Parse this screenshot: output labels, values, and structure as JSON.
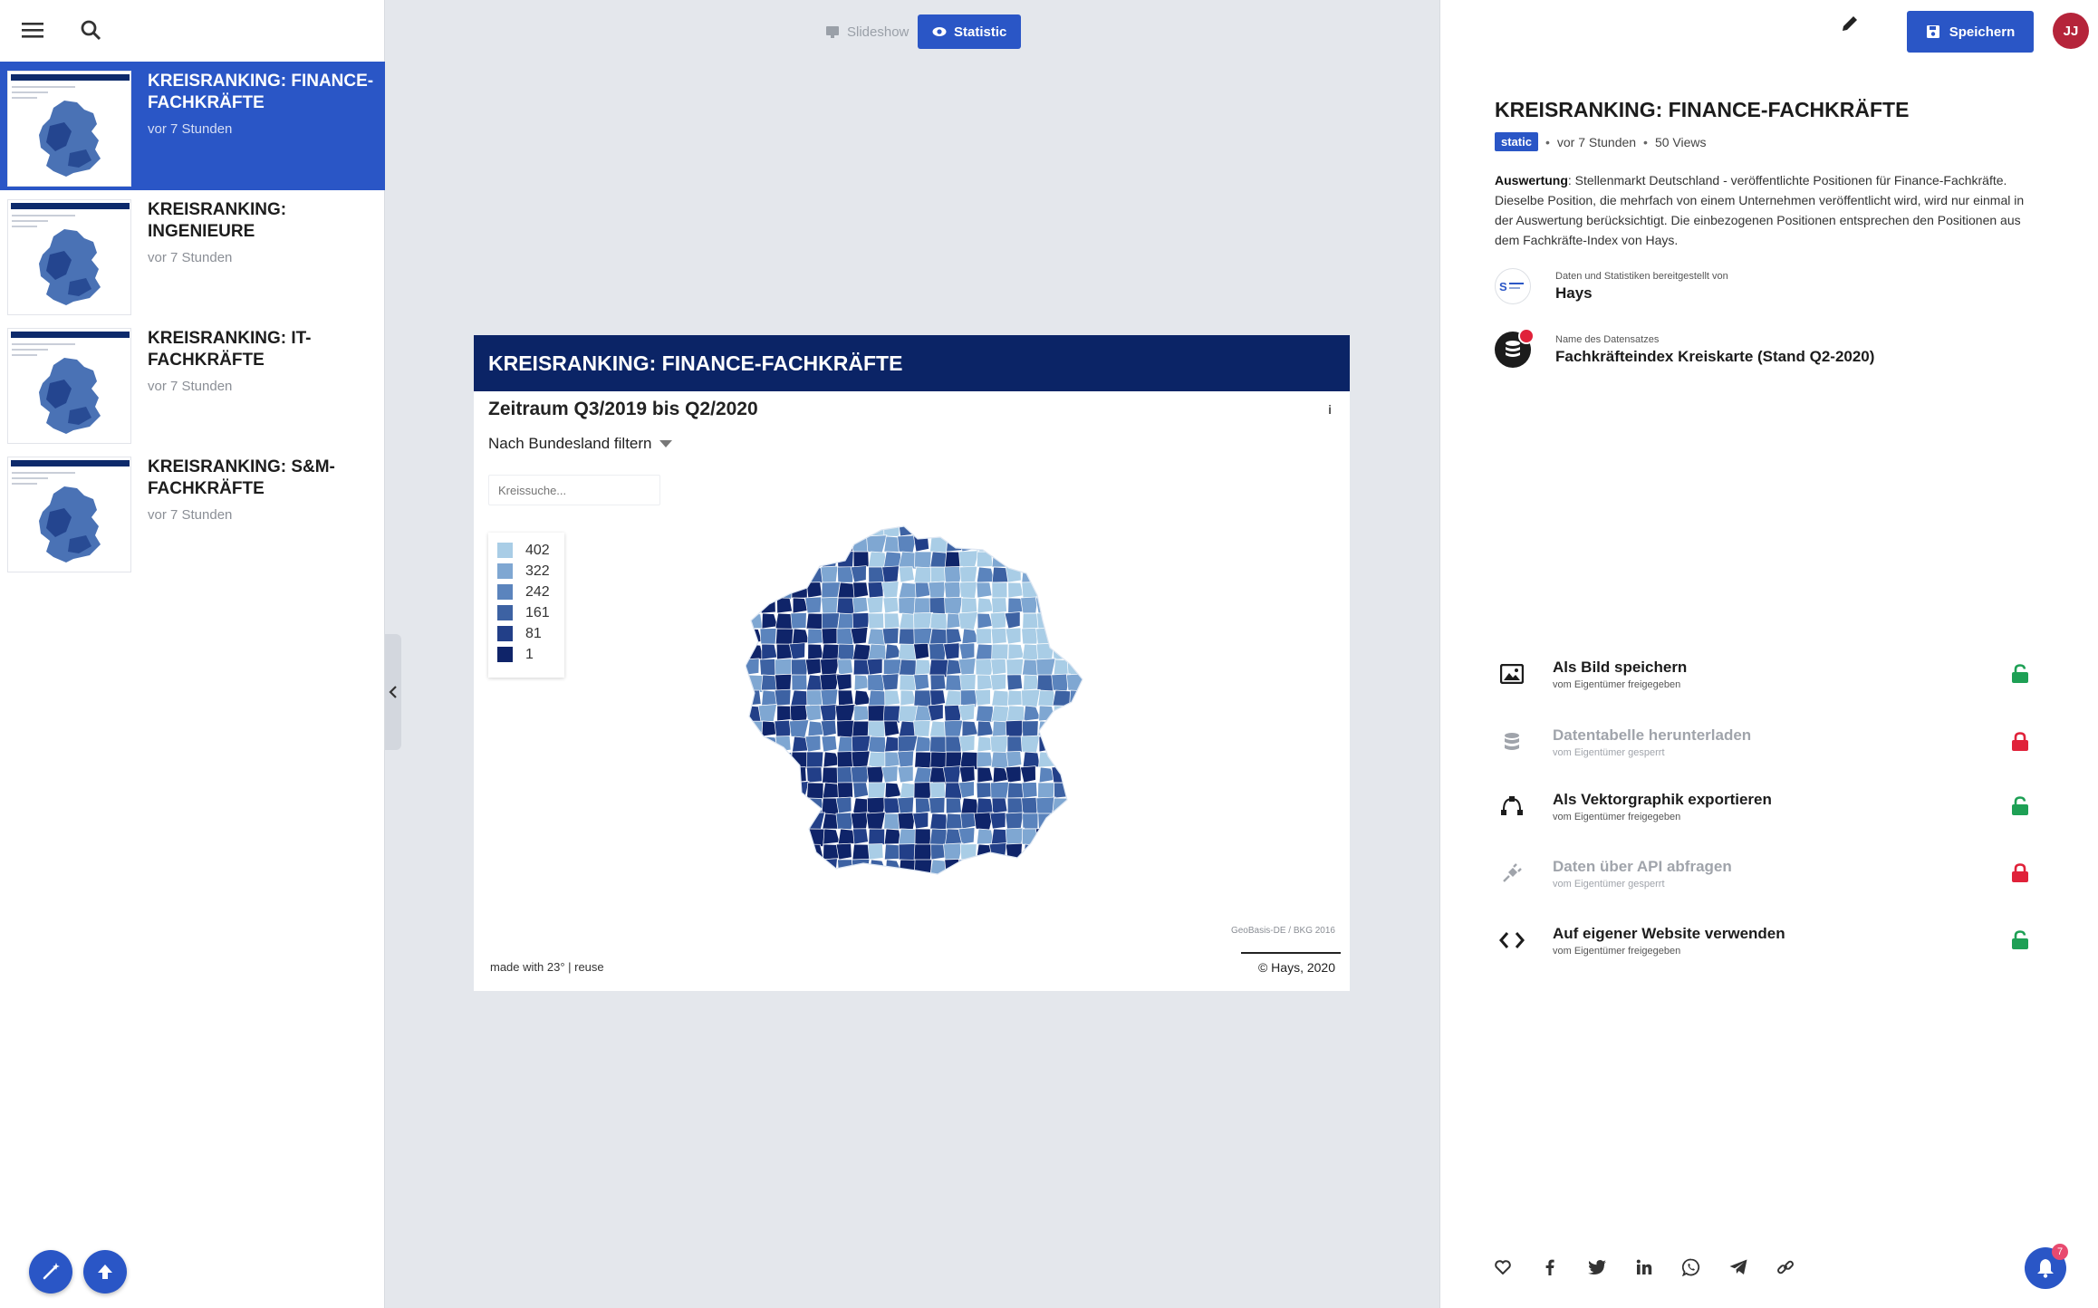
{
  "nav": {
    "slideshow_label": "Slideshow",
    "statistic_label": "Statistic"
  },
  "sidebar": {
    "items": [
      {
        "title": "KREISRANKING: FINANCE-FACHKRÄFTE",
        "time": "vor 7 Stunden",
        "active": true
      },
      {
        "title": "KREISRANKING: INGENIEURE",
        "time": "vor 7 Stunden",
        "active": false
      },
      {
        "title": "KREISRANKING: IT-FACHKRÄFTE",
        "time": "vor 7 Stunden",
        "active": false
      },
      {
        "title": "KREISRANKING: S&M-FACHKRÄFTE",
        "time": "vor 7 Stunden",
        "active": false
      }
    ]
  },
  "card": {
    "header": "KREISRANKING: FINANCE-FACHKRÄFTE",
    "subtitle": "Zeitraum Q3/2019 bis Q2/2020",
    "info": "i",
    "filter_label": "Nach Bundesland filtern",
    "search_placeholder": "Kreissuche...",
    "legend": [
      {
        "label": "402",
        "color": "#a9cde6"
      },
      {
        "label": "322",
        "color": "#7fa7d2"
      },
      {
        "label": "242",
        "color": "#5b84bd"
      },
      {
        "label": "161",
        "color": "#3d62a3"
      },
      {
        "label": "81",
        "color": "#223f88"
      },
      {
        "label": "1",
        "color": "#0f2469"
      }
    ],
    "source": "GeoBasis-DE / BKG 2016",
    "made_with": "made with 23° | reuse",
    "copyright": "© Hays, 2020"
  },
  "panel": {
    "save_label": "Speichern",
    "avatar_initials": "JJ",
    "title": "KREISRANKING: FINANCE-FACHKRÄFTE",
    "tag": "static",
    "time": "vor 7 Stunden",
    "views": "50 Views",
    "description_label": "Auswertung",
    "description": ": Stellenmarkt Deutschland - veröffentlichte Positionen für Finance-Fachkräfte. Dieselbe Position, die mehrfach von einem Unternehmen veröffentlicht wird, wird nur einmal in der Auswertung berücksichtigt. Die einbezogenen Positionen entsprechen den Positionen aus dem Fachkräfte-Index von Hays.",
    "provider_caption": "Daten und Statistiken bereitgestellt von",
    "provider_name": "Hays",
    "dataset_caption": "Name des Datensatzes",
    "dataset_name": "Fachkräfteindex Kreiskarte (Stand Q2-2020)",
    "actions": [
      {
        "label": "Als Bild speichern",
        "sub": "vom Eigentümer freigegeben",
        "enabled": true,
        "icon": "image-icon"
      },
      {
        "label": "Datentabelle herunterladen",
        "sub": "vom Eigentümer gesperrt",
        "enabled": false,
        "icon": "database-icon"
      },
      {
        "label": "Als Vektorgraphik exportieren",
        "sub": "vom Eigentümer freigegeben",
        "enabled": true,
        "icon": "vector-icon"
      },
      {
        "label": "Daten über API abfragen",
        "sub": "vom Eigentümer gesperrt",
        "enabled": false,
        "icon": "plug-icon"
      },
      {
        "label": "Auf eigener Website verwenden",
        "sub": "vom Eigentümer freigegeben",
        "enabled": true,
        "icon": "code-icon"
      }
    ],
    "notification_count": "7"
  },
  "colors": {
    "accent": "#2a56c6",
    "header_navy": "#0b2466",
    "unlocked": "#1ea055",
    "locked": "#e0223a"
  }
}
